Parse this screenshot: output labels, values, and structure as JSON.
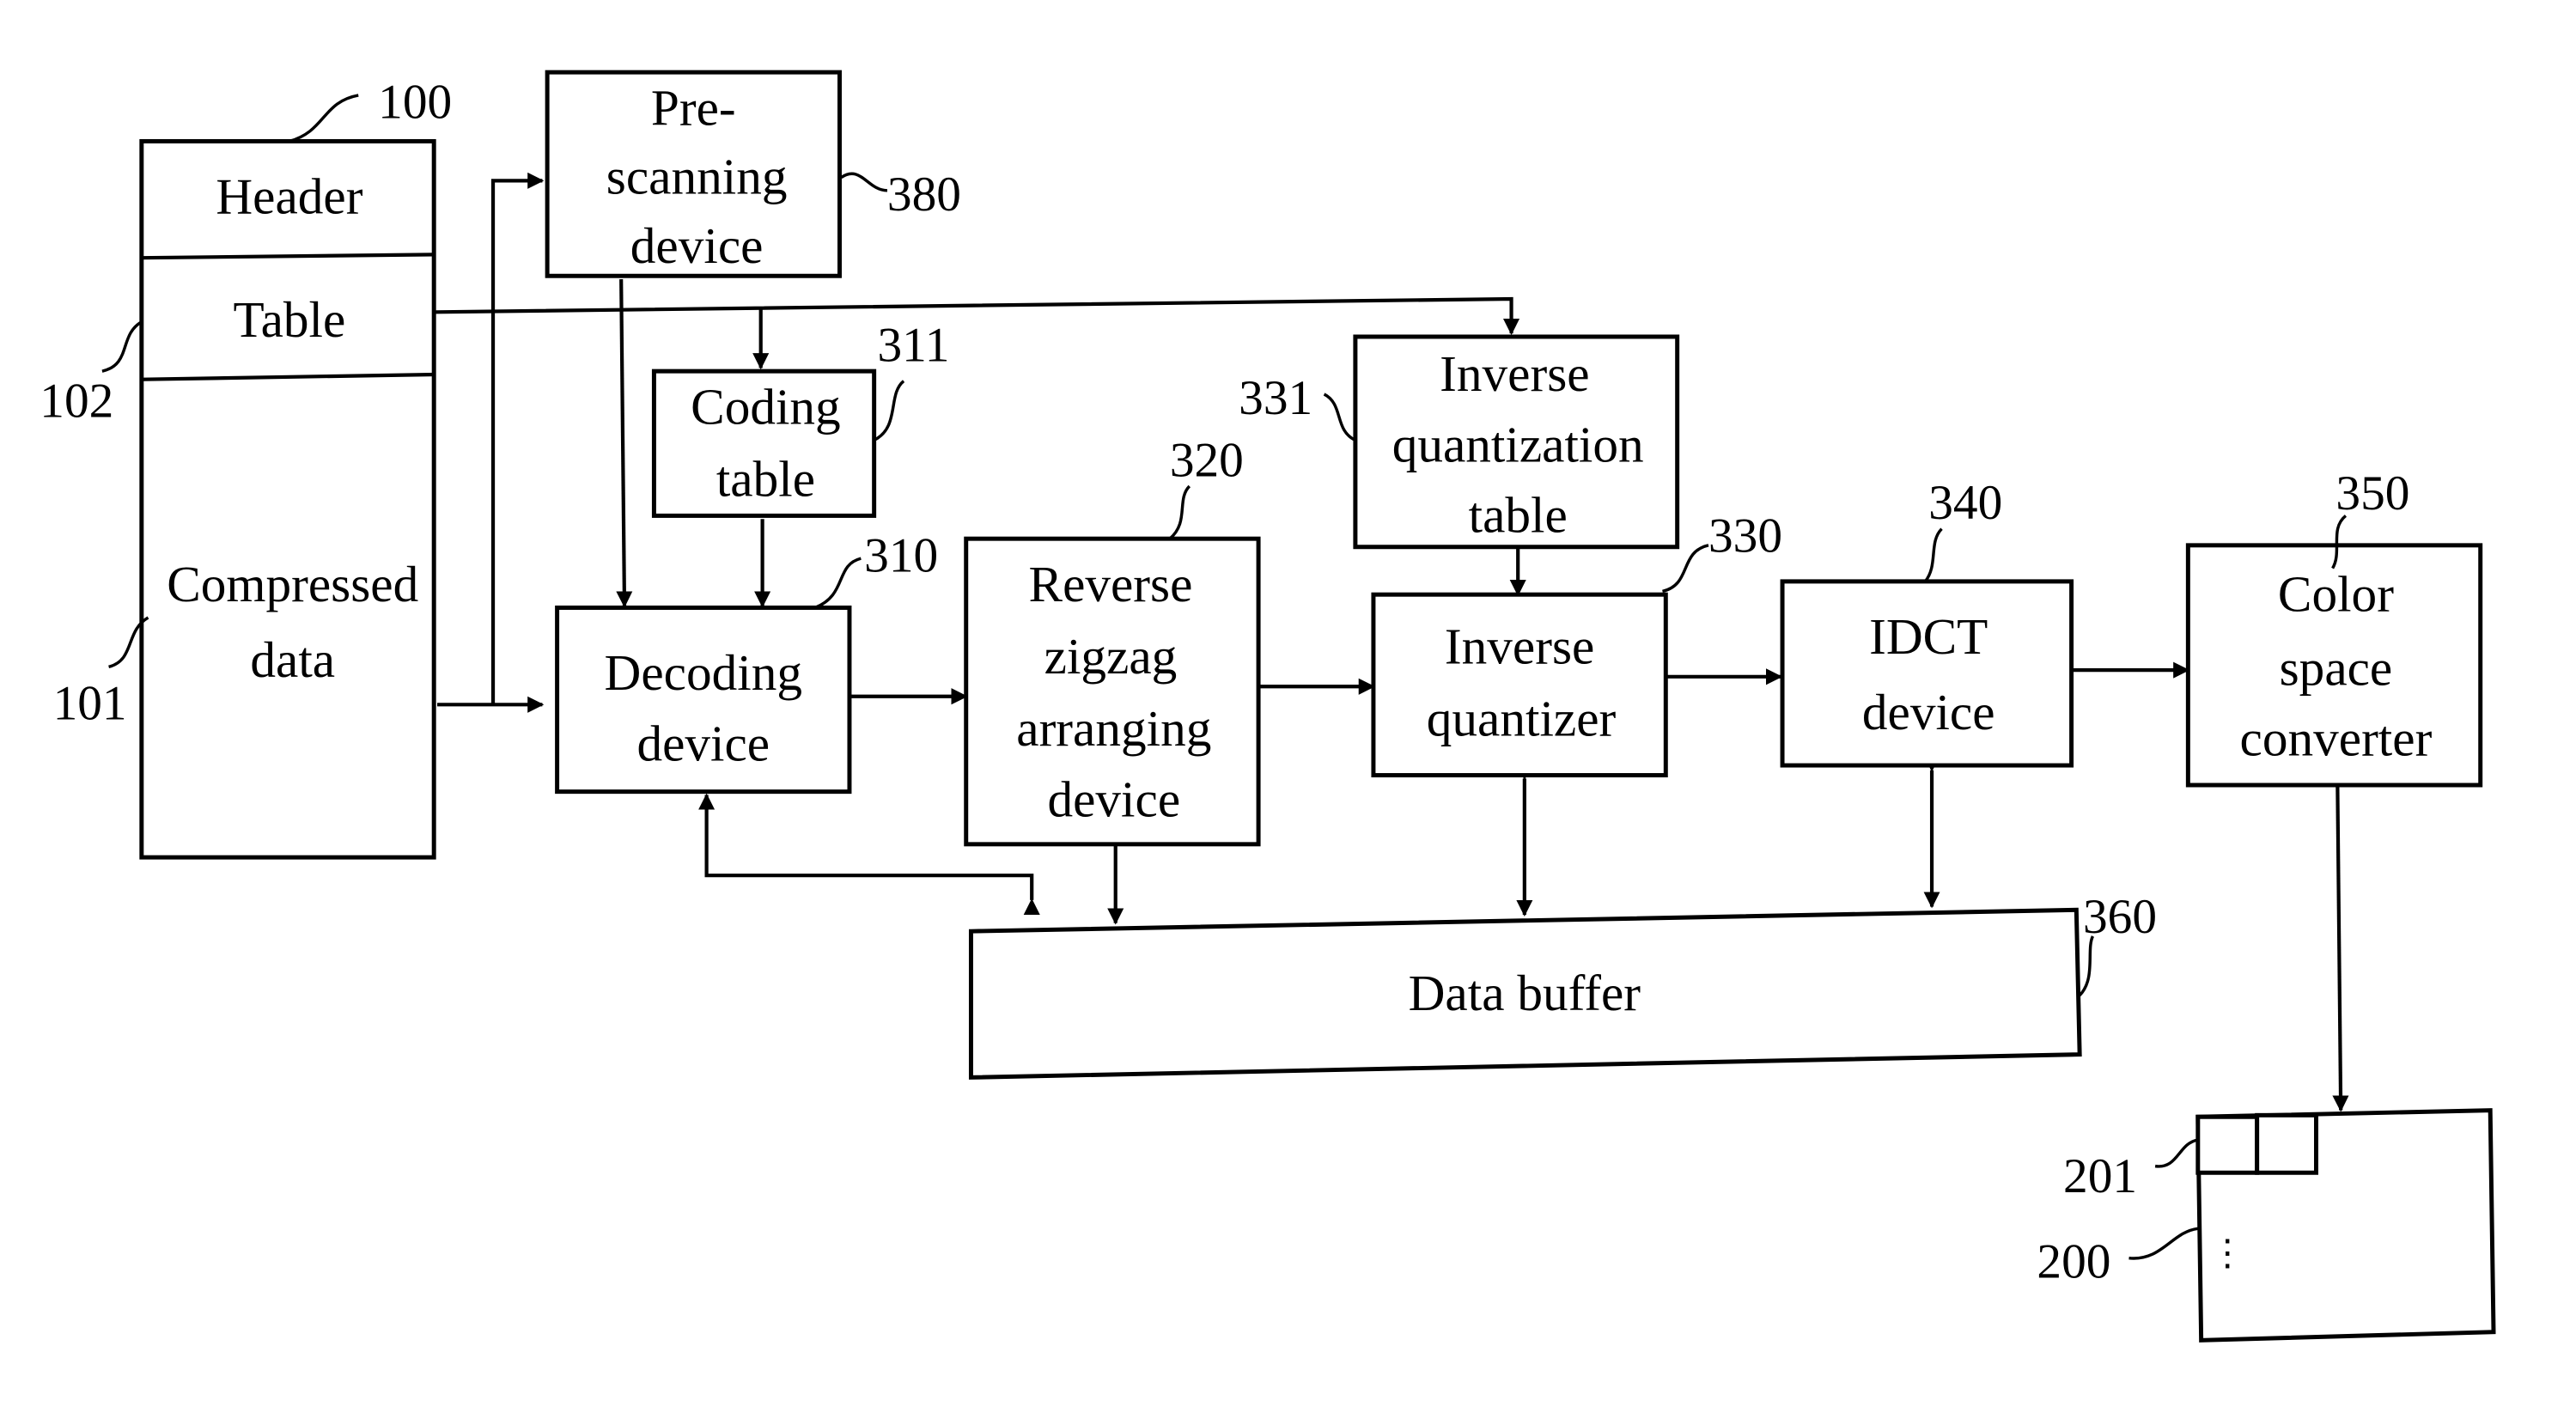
{
  "diagram": {
    "compressed_file": {
      "ref": "100",
      "sections": [
        {
          "name": "header",
          "label": "Header"
        },
        {
          "name": "table",
          "label": "Table",
          "ref": "102"
        },
        {
          "name": "compressed-data",
          "label_lines": [
            "Compressed",
            "data"
          ],
          "ref": "101"
        }
      ]
    },
    "blocks": {
      "prescanning": {
        "lines": [
          "Pre-",
          "scanning",
          "device"
        ],
        "ref": "380"
      },
      "coding_table": {
        "lines": [
          "Coding",
          "table"
        ],
        "ref": "311"
      },
      "decoding": {
        "lines": [
          "Decoding",
          "device"
        ],
        "ref": "310"
      },
      "reverse_zigzag": {
        "lines": [
          "Reverse",
          "zigzag",
          "arranging",
          "device"
        ],
        "ref": "320"
      },
      "iq_table": {
        "lines": [
          "Inverse",
          "quantization",
          "table"
        ],
        "ref": "331"
      },
      "inverse_quantizer": {
        "lines": [
          "Inverse",
          "quantizer"
        ],
        "ref": "330"
      },
      "idct": {
        "lines": [
          "IDCT",
          "device"
        ],
        "ref": "340"
      },
      "color_space": {
        "lines": [
          "Color",
          "space",
          "converter"
        ],
        "ref": "350"
      },
      "data_buffer": {
        "label": "Data buffer",
        "ref": "360"
      },
      "output_image": {
        "ref": "200",
        "block_ref": "201",
        "ellipsis": "⋮"
      }
    }
  }
}
